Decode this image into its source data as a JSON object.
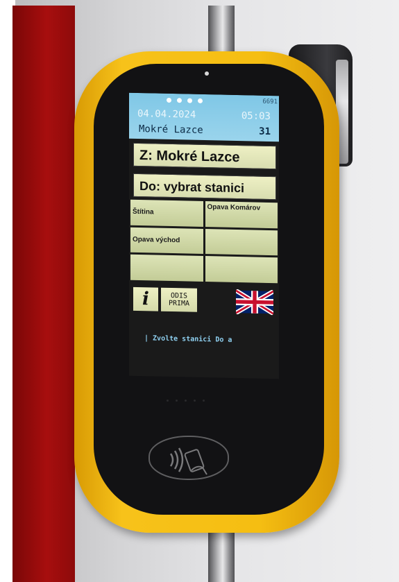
{
  "status": {
    "device_id": "6691",
    "date": "04.04.2024",
    "time": "05:03",
    "current_stop": "Mokré Lazce",
    "line_number": "31"
  },
  "route": {
    "from_label": "Z: Mokré Lazce",
    "to_label": "Do:  vybrat stanici"
  },
  "stations": [
    "Štítina",
    "Opava Komárov",
    "Opava východ",
    "",
    "",
    ""
  ],
  "buttons": {
    "info_label": "i",
    "odis_line1": "ODIS",
    "odis_line2": "PRIMA"
  },
  "hint": "| Zvolte stanici Do a",
  "colors": {
    "housing": "#f5be12",
    "status_bar": "#8fcde8",
    "button_bg": "#dfe4b8",
    "hint_text": "#8fd0f0"
  },
  "icons": [
    "contactless-card-icon",
    "uk-flag-icon"
  ]
}
